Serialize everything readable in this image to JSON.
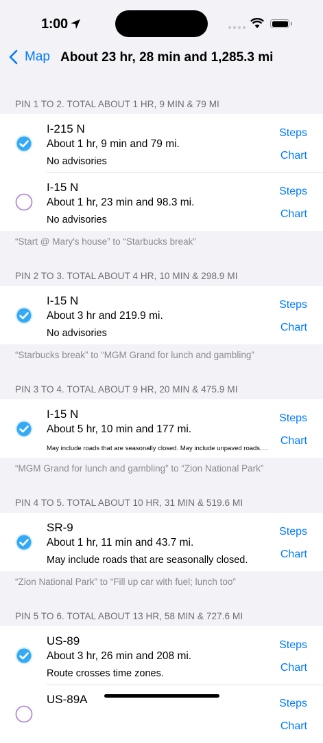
{
  "status": {
    "time": "1:00"
  },
  "nav": {
    "back_label": "Map",
    "title": "About 23 hr, 28 min and 1,285.3 mi"
  },
  "sections": [
    {
      "header": "PIN 1 TO 2. TOTAL ABOUT 1 HR, 9 MIN & 79 MI",
      "footer": "“Start @ Mary's house” to “Starbucks break”",
      "rows": [
        {
          "road": "I-215 N",
          "summary": "About 1 hr, 9 min and 79 mi.",
          "advisory": "No advisories",
          "selected": true
        },
        {
          "road": "I-15 N",
          "summary": "About 1 hr, 23 min and 98.3 mi.",
          "advisory": "No advisories",
          "selected": false
        }
      ]
    },
    {
      "header": "PIN 2 TO 3. TOTAL ABOUT 4 HR, 10 MIN & 298.9 MI",
      "footer": "“Starbucks break” to “MGM Grand for lunch and gambling”",
      "rows": [
        {
          "road": "I-15 N",
          "summary": "About 3 hr and 219.9 mi.",
          "advisory": "No advisories",
          "selected": true
        }
      ]
    },
    {
      "header": "PIN 3 TO 4. TOTAL ABOUT 9 HR, 20 MIN & 475.9 MI",
      "footer": "“MGM Grand for lunch and gambling” to “Zion National Park”",
      "rows": [
        {
          "road": "I-15 N",
          "summary": "About 5 hr, 10 min and 177 mi.",
          "advisory": "May include roads that are seasonally closed. May include unpaved roads. Directions may include ferries.",
          "selected": true,
          "small": true
        }
      ]
    },
    {
      "header": "PIN 4 TO 5. TOTAL ABOUT 10 HR, 31 MIN & 519.6 MI",
      "footer": "“Zion National Park” to “Fill up car with fuel; lunch too”",
      "rows": [
        {
          "road": "SR-9",
          "summary": "About 1 hr, 11 min and 43.7 mi.",
          "advisory": "May include roads that are seasonally closed.",
          "selected": true
        }
      ]
    },
    {
      "header": "PIN 5 TO 6. TOTAL ABOUT 13 HR, 58 MIN & 727.6 MI",
      "footer": "",
      "rows": [
        {
          "road": "US-89",
          "summary": "About 3 hr, 26 min and 208 mi.",
          "advisory": "Route crosses time zones.",
          "selected": true
        },
        {
          "road": "US-89A",
          "summary": "",
          "advisory": "",
          "selected": false
        }
      ]
    }
  ],
  "buttons": {
    "steps": "Steps",
    "chart": "Chart"
  },
  "colors": {
    "accent": "#007aff",
    "check_fill": "#34aaf5",
    "unselected_ring": "#b48ad9"
  }
}
